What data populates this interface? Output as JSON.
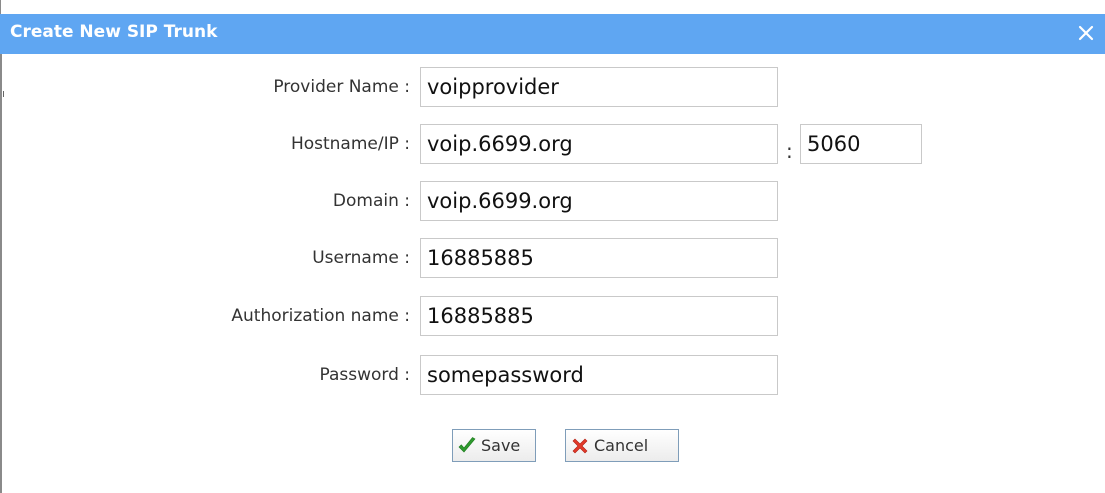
{
  "dialog": {
    "title": "Create New SIP Trunk",
    "close_icon": "close-icon",
    "accent_color": "#5fa6f2"
  },
  "form": {
    "provider_name": {
      "label": "Provider Name :",
      "value": "voipprovider"
    },
    "hostname": {
      "label": "Hostname/IP :",
      "value": "voip.6699.org",
      "port_separator": ":",
      "port": "5060"
    },
    "domain": {
      "label": "Domain :",
      "value": "voip.6699.org"
    },
    "username": {
      "label": "Username :",
      "value": "16885885"
    },
    "authorization_name": {
      "label": "Authorization name :",
      "value": "16885885"
    },
    "password": {
      "label": "Password :",
      "value": "somepassword"
    }
  },
  "buttons": {
    "save": {
      "label": "Save",
      "icon": "checkmark-icon"
    },
    "cancel": {
      "label": "Cancel",
      "icon": "cross-icon"
    }
  }
}
